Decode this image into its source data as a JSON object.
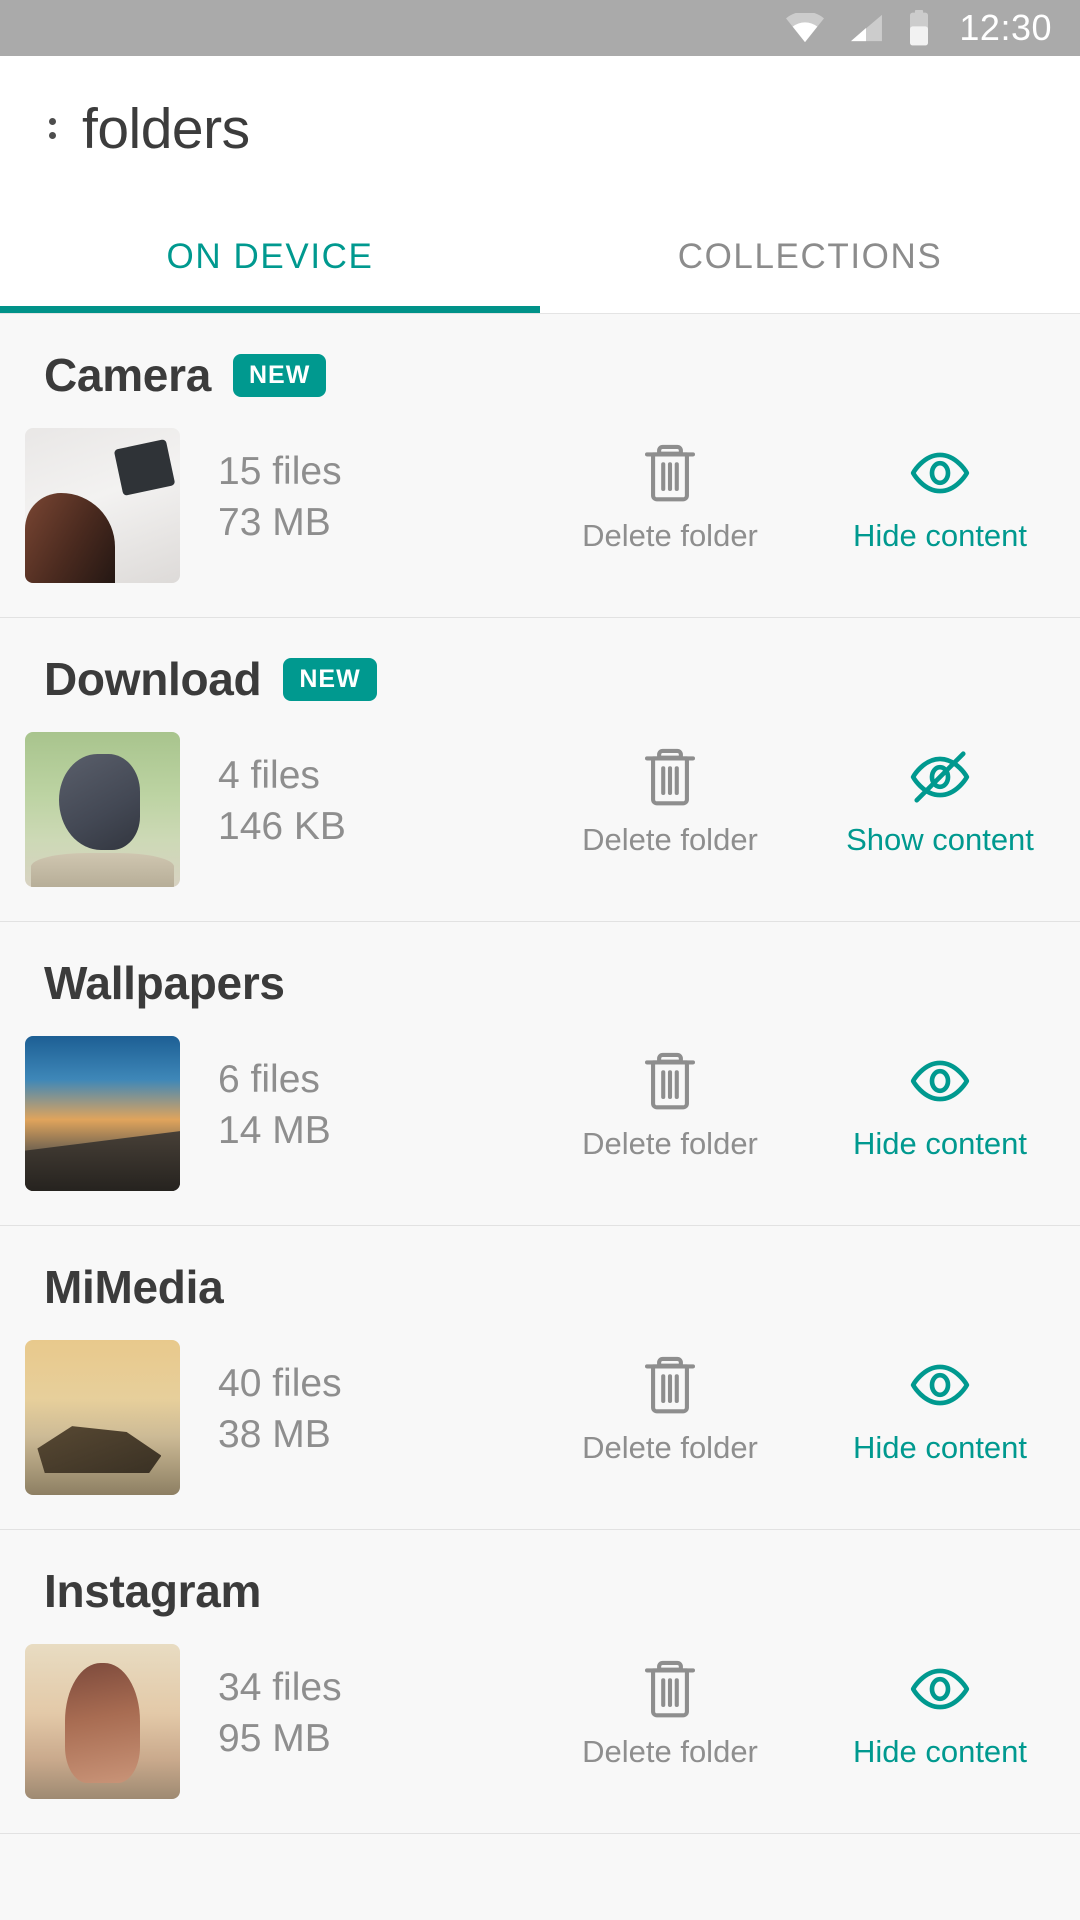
{
  "status_bar": {
    "time": "12:30",
    "icons": [
      "wifi-icon",
      "cellular-signal-icon",
      "battery-icon"
    ]
  },
  "app_bar": {
    "title": "folders",
    "overflow_menu": "overflow-menu-icon"
  },
  "tabs": [
    {
      "label": "ON DEVICE",
      "active": true
    },
    {
      "label": "COLLECTIONS",
      "active": false
    }
  ],
  "colors": {
    "accent_teal": "#00998f",
    "indicator_teal": "#009289",
    "muted_gray": "#8e8e8e",
    "title_dark": "#3b3b3b",
    "status_bar_gray": "#aaaaaa",
    "list_background": "#f8f8f8"
  },
  "folders": [
    {
      "name": "Camera",
      "badge": "NEW",
      "file_count": "15 files",
      "size": "73 MB",
      "thumb_class": "thumb-camera",
      "delete_label": "Delete folder",
      "visibility_label": "Hide content",
      "visibility_icon": "eye-icon",
      "hidden": false
    },
    {
      "name": "Download",
      "badge": "NEW",
      "file_count": "4 files",
      "size": "146 KB",
      "thumb_class": "thumb-bird",
      "delete_label": "Delete folder",
      "visibility_label": "Show content",
      "visibility_icon": "eye-off-icon",
      "hidden": true
    },
    {
      "name": "Wallpapers",
      "badge": "",
      "file_count": "6 files",
      "size": "14 MB",
      "thumb_class": "thumb-wall",
      "delete_label": "Delete folder",
      "visibility_label": "Hide content",
      "visibility_icon": "eye-icon",
      "hidden": false
    },
    {
      "name": "MiMedia",
      "badge": "",
      "file_count": "40 files",
      "size": "38 MB",
      "thumb_class": "thumb-mimedia",
      "delete_label": "Delete folder",
      "visibility_label": "Hide content",
      "visibility_icon": "eye-icon",
      "hidden": false
    },
    {
      "name": "Instagram",
      "badge": "",
      "file_count": "34 files",
      "size": "95 MB",
      "thumb_class": "thumb-insta",
      "delete_label": "Delete folder",
      "visibility_label": "Hide content",
      "visibility_icon": "eye-icon",
      "hidden": false
    }
  ]
}
